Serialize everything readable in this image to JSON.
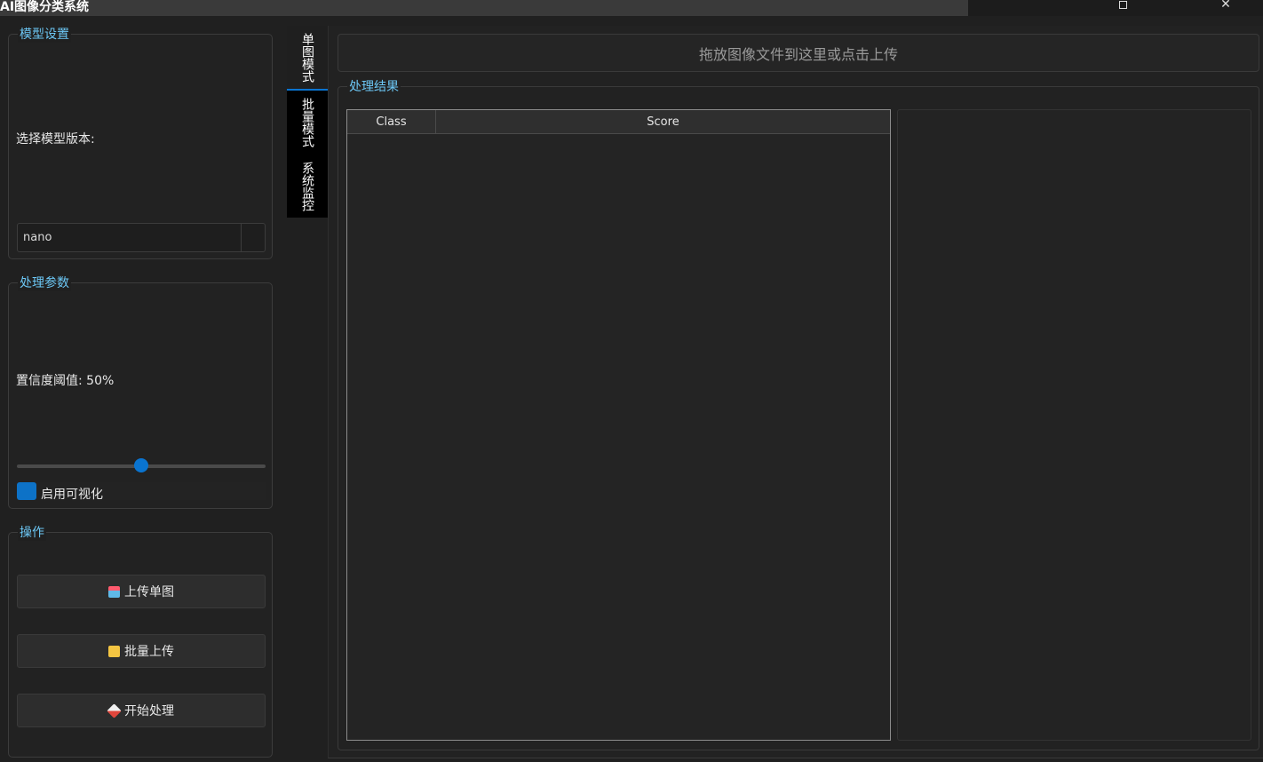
{
  "app": {
    "title": "AI图像分类系统",
    "window_controls": {
      "maximize": "maximize-icon",
      "close": "✕"
    }
  },
  "model_settings": {
    "title": "模型设置",
    "version_label": "选择模型版本:",
    "version_value": "nano"
  },
  "processing_params": {
    "title": "处理参数",
    "confidence_label": "置信度阈值: 50%",
    "confidence_value": 0.5,
    "visualize_label": "启用可视化",
    "visualize_checked": true
  },
  "operations": {
    "title": "操作",
    "buttons": [
      {
        "label": "上传单图",
        "icon": "upload-image-icon"
      },
      {
        "label": "批量上传",
        "icon": "folder-icon"
      },
      {
        "label": "开始处理",
        "icon": "rocket-icon"
      }
    ]
  },
  "tabs": [
    {
      "label": "单图模式",
      "active": true
    },
    {
      "label": "批量模式",
      "active": false
    },
    {
      "label": "系统监控",
      "active": false
    }
  ],
  "drop_zone": {
    "text": "拖放图像文件到这里或点击上传"
  },
  "results": {
    "title": "处理结果",
    "columns": [
      "Class",
      "Score"
    ],
    "rows": []
  },
  "colors": {
    "accent": "#0a74d0",
    "group_title": "#6cc7f5",
    "background": "#202020"
  }
}
